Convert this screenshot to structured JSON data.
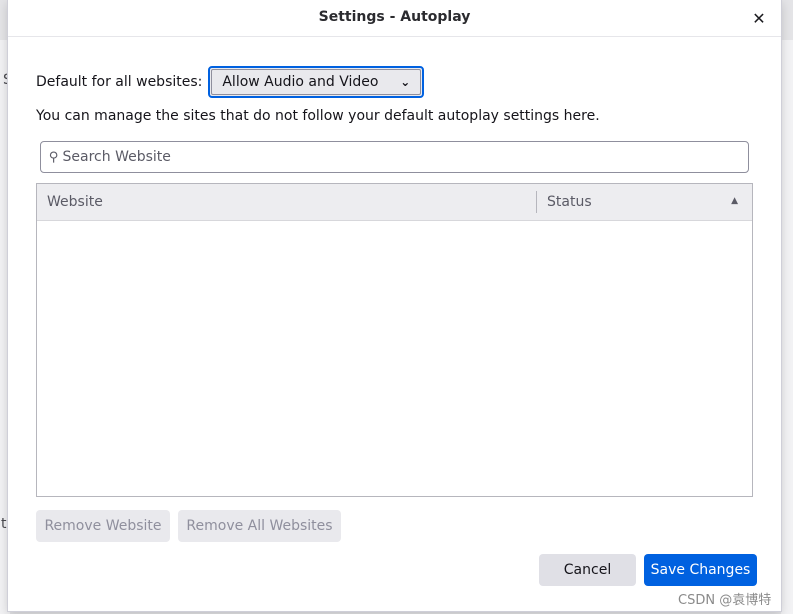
{
  "window": {
    "title": "Settings - Autoplay",
    "close_icon": "close-icon"
  },
  "background": {
    "fragment_top": "S",
    "fragment_bottom": "t"
  },
  "default_setting": {
    "label": "Default for all websites:",
    "selected_value": "Allow Audio and Video",
    "chevron_icon": "chevron-down-icon"
  },
  "description": "You can manage the sites that do not follow your default autoplay settings here.",
  "search": {
    "placeholder": "Search Website",
    "value": "",
    "icon": "search-icon"
  },
  "table": {
    "columns": [
      "Website",
      "Status"
    ],
    "rows": [],
    "sort_icon": "sort-ascending-icon"
  },
  "buttons": {
    "remove_website": "Remove Website",
    "remove_all_websites": "Remove All Websites",
    "cancel": "Cancel",
    "save_changes": "Save Changes"
  },
  "colors": {
    "accent": "#0061e0"
  },
  "watermark": "CSDN @袁博特"
}
